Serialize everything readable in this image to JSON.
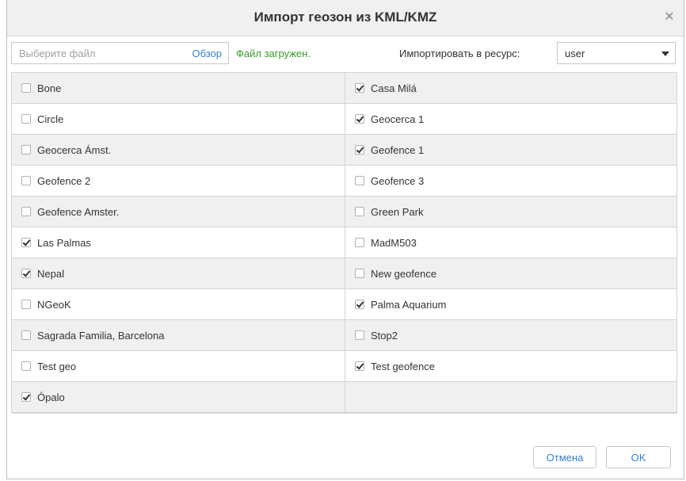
{
  "dialog": {
    "title": "Импорт геозон из KML/KMZ",
    "close_icon": "close-icon"
  },
  "file": {
    "placeholder": "Выберите файл",
    "value": "",
    "browse_label": "Обзор",
    "status": "Файл загружен."
  },
  "resource": {
    "label": "Импортировать в ресурс:",
    "selected": "user"
  },
  "items": [
    {
      "label": "Bone",
      "checked": false
    },
    {
      "label": "Casa Milá",
      "checked": true
    },
    {
      "label": "Circle",
      "checked": false
    },
    {
      "label": "Geocerca 1",
      "checked": true
    },
    {
      "label": "Geocerca Ámst.",
      "checked": false
    },
    {
      "label": "Geofence 1",
      "checked": true
    },
    {
      "label": "Geofence 2",
      "checked": false
    },
    {
      "label": "Geofence 3",
      "checked": false
    },
    {
      "label": "Geofence Amster.",
      "checked": false
    },
    {
      "label": "Green Park",
      "checked": false
    },
    {
      "label": "Las Palmas",
      "checked": true
    },
    {
      "label": "MadM503",
      "checked": false
    },
    {
      "label": "Nepal",
      "checked": true
    },
    {
      "label": "New geofence",
      "checked": false
    },
    {
      "label": "NGeoK",
      "checked": false
    },
    {
      "label": "Palma Aquarium",
      "checked": true
    },
    {
      "label": "Sagrada Familia, Barcelona",
      "checked": false
    },
    {
      "label": "Stop2",
      "checked": false
    },
    {
      "label": "Test geo",
      "checked": false
    },
    {
      "label": "Test geofence",
      "checked": true
    },
    {
      "label": "Ópalo",
      "checked": true
    }
  ],
  "buttons": {
    "cancel": "Отмена",
    "ok": "OK"
  },
  "colors": {
    "accent": "#3a7fc4",
    "status": "#3c9a2e",
    "row_alt": "#f0f0f0"
  }
}
